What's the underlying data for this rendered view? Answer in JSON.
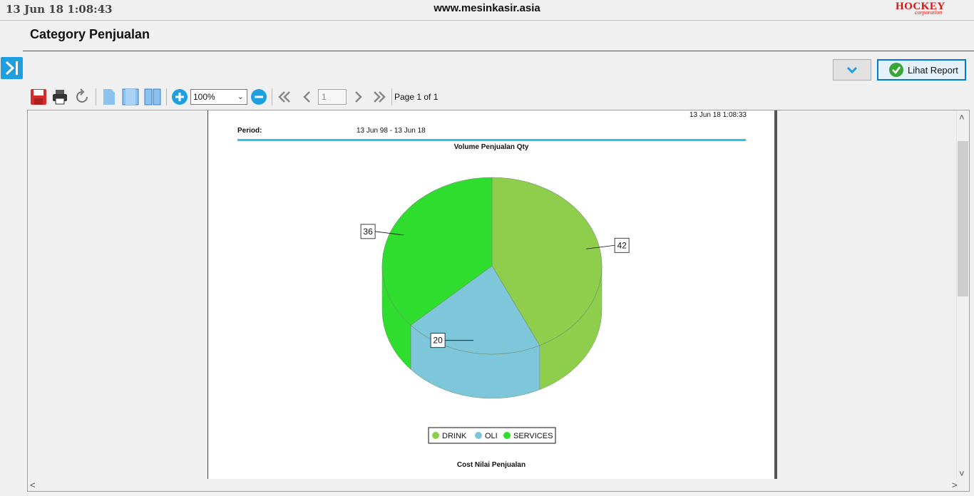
{
  "header": {
    "datetime": "13 Jun 18  1:08:43",
    "site": "www.mesinkasir.asia",
    "brand": "HOCKEY",
    "brand_sub": "corporation"
  },
  "page": {
    "title": "Category Penjualan"
  },
  "actions": {
    "report_label": "Lihat Report"
  },
  "toolbar": {
    "zoom_value": "100%",
    "page_input": "1",
    "page_label": "Page 1 of 1",
    "icons": [
      "save-icon",
      "print-icon",
      "refresh-icon",
      "single-page-icon",
      "fit-width-icon",
      "two-page-icon",
      "zoom-in-icon",
      "zoom-out-icon",
      "first-page-icon",
      "prev-page-icon",
      "next-page-icon",
      "last-page-icon"
    ]
  },
  "report": {
    "printed": "13 Jun 18 1:08:33",
    "period_label": "Period:",
    "period_value": "13 Jun 98  -  13 Jun 18",
    "chart_title": "Volume Penjualan Qty",
    "next_section": "Cost Nilai Penjualan"
  },
  "chart_data": {
    "type": "pie",
    "title": "Volume Penjualan Qty",
    "categories": [
      "DRINK",
      "OLI",
      "SERVICES"
    ],
    "values": [
      42,
      20,
      36
    ],
    "colors": [
      "#8fce4c",
      "#7ec6d9",
      "#2edd2e"
    ],
    "legend": "bottom"
  },
  "colors": {
    "accent": "#1e9fe0",
    "period_rule": "#29c3ee"
  }
}
